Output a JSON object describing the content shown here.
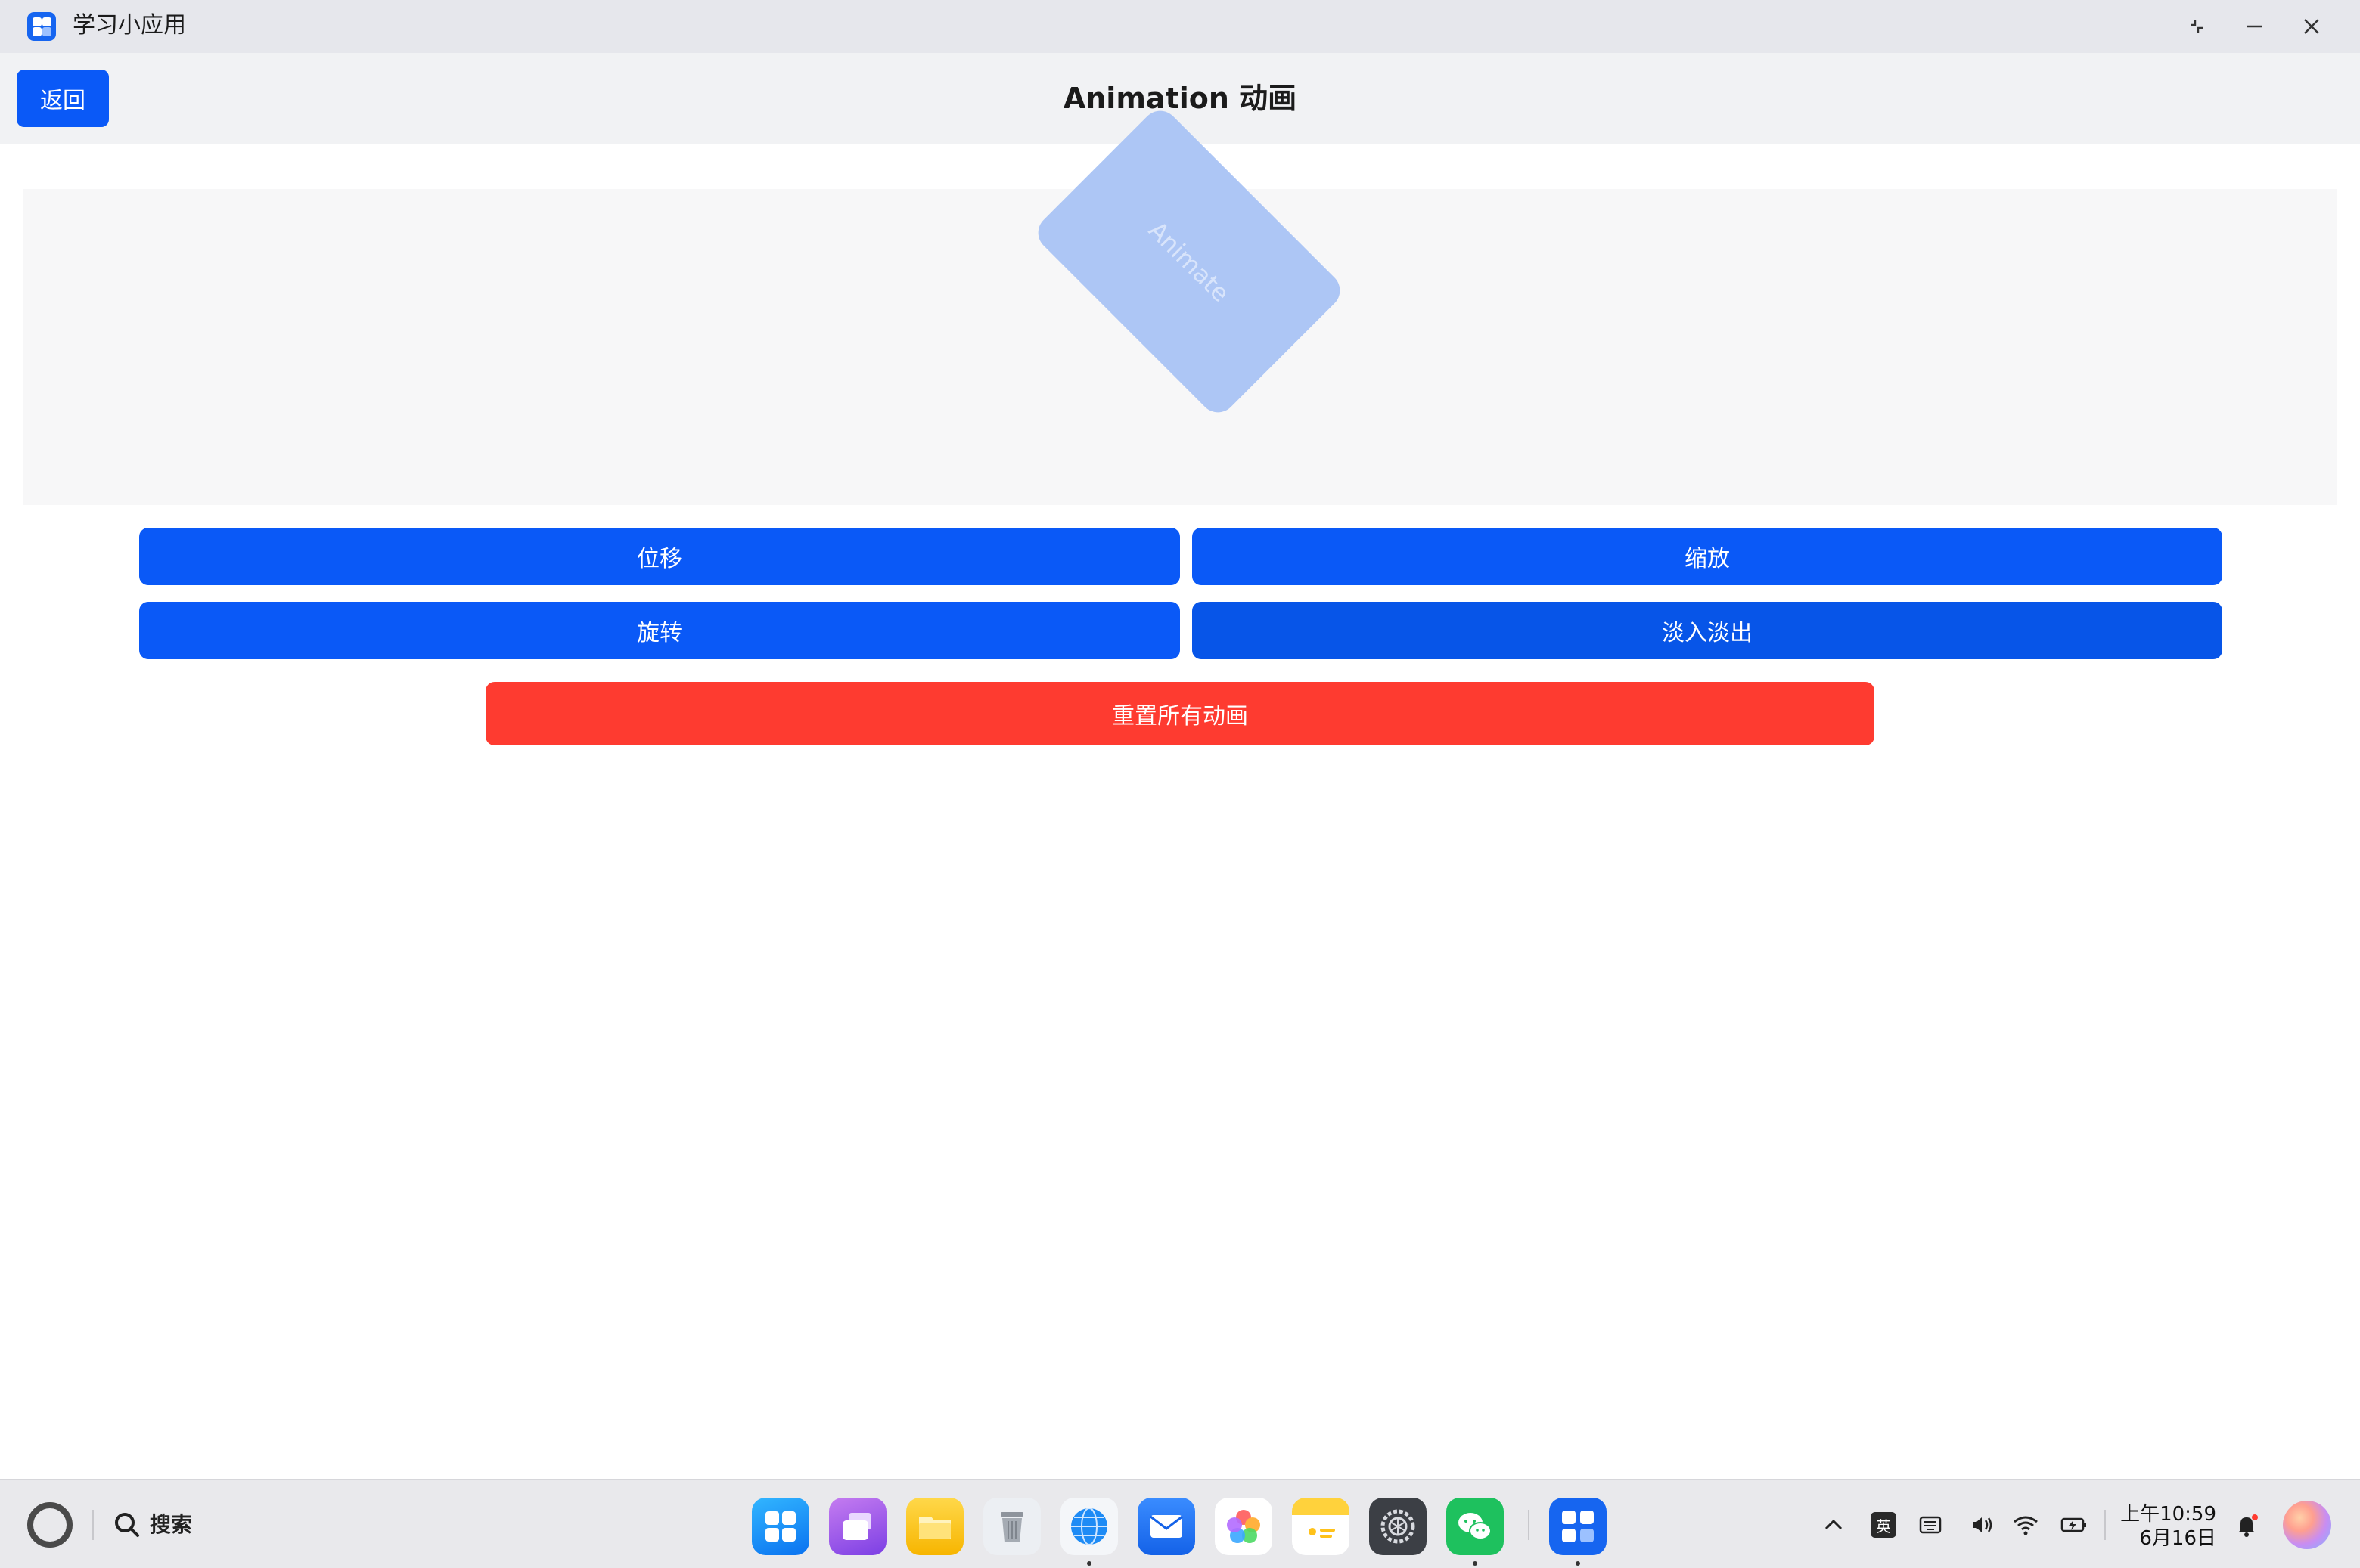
{
  "window": {
    "title": "学习小应用",
    "controls": [
      "restore-icon",
      "minimize-icon",
      "close-icon"
    ]
  },
  "header": {
    "back_label": "返回",
    "title": "Animation 动画"
  },
  "stage": {
    "box_label": "Animate",
    "box_rotation_deg": 45,
    "box_color": "#adc6f5"
  },
  "buttons": {
    "translate": "位移",
    "scale": "缩放",
    "rotate": "旋转",
    "fade": "淡入淡出",
    "reset": "重置所有动画"
  },
  "colors": {
    "primary": "#0a59f7",
    "danger": "#fe3b30"
  },
  "taskbar": {
    "search_label": "搜索",
    "dock_apps": [
      "app-center-icon",
      "multitask-icon",
      "files-icon",
      "trash-icon",
      "browser-icon",
      "mail-icon",
      "gallery-icon",
      "notes-icon",
      "settings-icon",
      "wechat-icon",
      "study-app-icon"
    ],
    "ime": "英",
    "clock": {
      "time": "上午10:59",
      "date": "6月16日"
    }
  }
}
